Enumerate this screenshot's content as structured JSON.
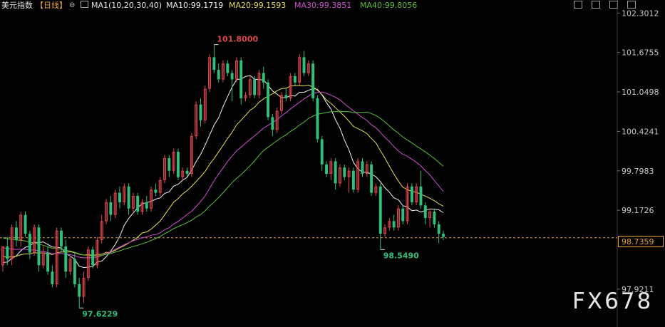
{
  "header": {
    "title": "美元指数",
    "period": "【日线】",
    "ma_label": "MA1(10,20,30,40)",
    "ma10": "MA10:99.1719",
    "ma20": "MA20:99.1593",
    "ma30": "MA30:99.3851",
    "ma40": "MA40:99.8056"
  },
  "watermark": "FX678",
  "colors": {
    "up": "#e0484a",
    "down": "#2fc07a",
    "ma10": "#f2f2f2",
    "ma20": "#e6df55",
    "ma30": "#d14dd6",
    "ma40": "#58c234",
    "current": "#e8a33a"
  },
  "chart_data": {
    "type": "candlestick",
    "y_axis_ticks": [
      "102.3012",
      "101.6755",
      "101.0498",
      "100.4241",
      "99.7983",
      "99.1726",
      "97.9211"
    ],
    "ylim": [
      97.4,
      102.35
    ],
    "current_price": "98.7359",
    "annotations": {
      "high": "101.8000",
      "low_left": "97.6229",
      "low_right": "98.5490"
    },
    "candles": [
      [
        98.3,
        98.6,
        98.6,
        98.2
      ],
      [
        98.6,
        98.4,
        98.75,
        98.3
      ],
      [
        98.4,
        98.9,
        98.95,
        98.3
      ],
      [
        98.9,
        98.7,
        99.0,
        98.6
      ],
      [
        98.7,
        99.1,
        99.15,
        98.6
      ],
      [
        99.1,
        98.8,
        99.15,
        98.75
      ],
      [
        98.8,
        98.5,
        98.85,
        98.4
      ],
      [
        98.5,
        98.9,
        98.95,
        98.45
      ],
      [
        98.9,
        98.3,
        98.95,
        98.2
      ],
      [
        98.3,
        98.5,
        98.6,
        98.25
      ],
      [
        98.5,
        98.2,
        98.6,
        98.15
      ],
      [
        98.2,
        98.0,
        98.3,
        97.95
      ],
      [
        98.0,
        98.85,
        98.9,
        97.95
      ],
      [
        98.85,
        98.6,
        98.9,
        98.5
      ],
      [
        98.6,
        98.2,
        98.7,
        98.1
      ],
      [
        98.2,
        98.4,
        98.45,
        98.15
      ],
      [
        98.4,
        98.0,
        98.5,
        97.95
      ],
      [
        98.0,
        97.8,
        98.1,
        97.62
      ],
      [
        97.8,
        98.1,
        98.2,
        97.7
      ],
      [
        98.1,
        98.55,
        98.6,
        98.05
      ],
      [
        98.55,
        98.3,
        98.6,
        98.25
      ],
      [
        98.3,
        98.7,
        98.75,
        98.25
      ],
      [
        98.7,
        99.0,
        99.1,
        98.65
      ],
      [
        99.0,
        99.3,
        99.35,
        98.95
      ],
      [
        99.3,
        99.1,
        99.4,
        99.0
      ],
      [
        99.1,
        99.45,
        99.5,
        99.05
      ],
      [
        99.45,
        99.3,
        99.55,
        99.2
      ],
      [
        99.3,
        99.55,
        99.6,
        99.25
      ],
      [
        99.55,
        99.2,
        99.6,
        99.1
      ],
      [
        99.2,
        99.4,
        99.45,
        99.15
      ],
      [
        99.4,
        99.15,
        99.45,
        99.1
      ],
      [
        99.15,
        99.3,
        99.35,
        99.1
      ],
      [
        99.3,
        99.2,
        99.4,
        99.15
      ],
      [
        99.2,
        99.5,
        99.55,
        99.15
      ],
      [
        99.5,
        99.45,
        99.6,
        99.4
      ],
      [
        99.45,
        99.65,
        99.7,
        99.4
      ],
      [
        99.65,
        100.0,
        100.05,
        99.6
      ],
      [
        100.0,
        99.8,
        100.05,
        99.7
      ],
      [
        99.8,
        100.1,
        100.15,
        99.75
      ],
      [
        100.1,
        99.7,
        100.15,
        99.65
      ],
      [
        99.7,
        99.8,
        99.85,
        99.65
      ],
      [
        99.8,
        99.75,
        99.85,
        99.7
      ],
      [
        99.75,
        100.35,
        100.4,
        99.7
      ],
      [
        100.35,
        100.85,
        100.9,
        100.3
      ],
      [
        100.85,
        100.6,
        100.95,
        100.5
      ],
      [
        100.6,
        101.1,
        101.15,
        100.55
      ],
      [
        101.1,
        101.6,
        101.65,
        101.05
      ],
      [
        101.6,
        101.4,
        101.8,
        101.35
      ],
      [
        101.4,
        101.25,
        101.5,
        101.2
      ],
      [
        101.25,
        101.5,
        101.55,
        101.2
      ],
      [
        101.5,
        101.35,
        101.55,
        101.3
      ],
      [
        101.35,
        101.25,
        101.4,
        100.9
      ],
      [
        101.25,
        101.55,
        101.6,
        101.2
      ],
      [
        101.55,
        100.95,
        101.6,
        100.85
      ],
      [
        100.95,
        101.0,
        101.05,
        100.9
      ],
      [
        101.0,
        101.25,
        101.3,
        100.95
      ],
      [
        101.25,
        101.0,
        101.3,
        100.95
      ],
      [
        101.0,
        101.35,
        101.4,
        100.95
      ],
      [
        101.35,
        101.2,
        101.45,
        101.1
      ],
      [
        101.2,
        100.65,
        101.25,
        100.6
      ],
      [
        100.65,
        100.45,
        100.7,
        100.35
      ],
      [
        100.45,
        100.75,
        100.8,
        100.4
      ],
      [
        100.75,
        101.0,
        101.05,
        100.7
      ],
      [
        101.0,
        100.95,
        101.1,
        100.9
      ],
      [
        100.95,
        101.3,
        101.35,
        100.9
      ],
      [
        101.3,
        101.2,
        101.35,
        101.15
      ],
      [
        101.2,
        101.6,
        101.65,
        101.15
      ],
      [
        101.6,
        101.35,
        101.7,
        101.3
      ],
      [
        101.35,
        101.5,
        101.55,
        101.3
      ],
      [
        101.5,
        100.95,
        101.55,
        100.9
      ],
      [
        100.95,
        100.3,
        101.0,
        100.25
      ],
      [
        100.3,
        99.9,
        100.35,
        99.8
      ],
      [
        99.9,
        99.75,
        99.95,
        99.7
      ],
      [
        99.75,
        99.95,
        100.0,
        99.65
      ],
      [
        99.95,
        99.6,
        100.0,
        99.5
      ],
      [
        99.6,
        99.85,
        99.9,
        99.55
      ],
      [
        99.85,
        99.7,
        99.9,
        99.65
      ],
      [
        99.7,
        99.8,
        99.85,
        99.45
      ],
      [
        99.8,
        99.5,
        99.85,
        99.45
      ],
      [
        99.5,
        99.95,
        100.0,
        99.45
      ],
      [
        99.95,
        99.75,
        100.0,
        99.7
      ],
      [
        99.75,
        99.9,
        99.95,
        99.7
      ],
      [
        99.9,
        99.45,
        99.95,
        99.4
      ],
      [
        99.45,
        99.55,
        99.6,
        99.4
      ],
      [
        99.55,
        98.8,
        99.6,
        98.55
      ],
      [
        98.8,
        98.9,
        98.95,
        98.75
      ],
      [
        98.9,
        99.0,
        99.05,
        98.85
      ],
      [
        99.0,
        98.9,
        99.1,
        98.85
      ],
      [
        98.9,
        99.2,
        99.25,
        98.85
      ],
      [
        99.2,
        99.0,
        99.25,
        98.95
      ],
      [
        99.0,
        99.55,
        99.6,
        98.95
      ],
      [
        99.55,
        99.3,
        99.6,
        99.25
      ],
      [
        99.3,
        99.55,
        99.6,
        99.25
      ],
      [
        99.55,
        99.25,
        99.8,
        99.2
      ],
      [
        99.25,
        99.05,
        99.3,
        98.95
      ],
      [
        99.05,
        99.15,
        99.2,
        98.9
      ],
      [
        99.15,
        98.95,
        99.2,
        98.9
      ],
      [
        98.95,
        98.8,
        99.0,
        98.65
      ],
      [
        98.8,
        98.75,
        98.85,
        98.7
      ]
    ]
  }
}
